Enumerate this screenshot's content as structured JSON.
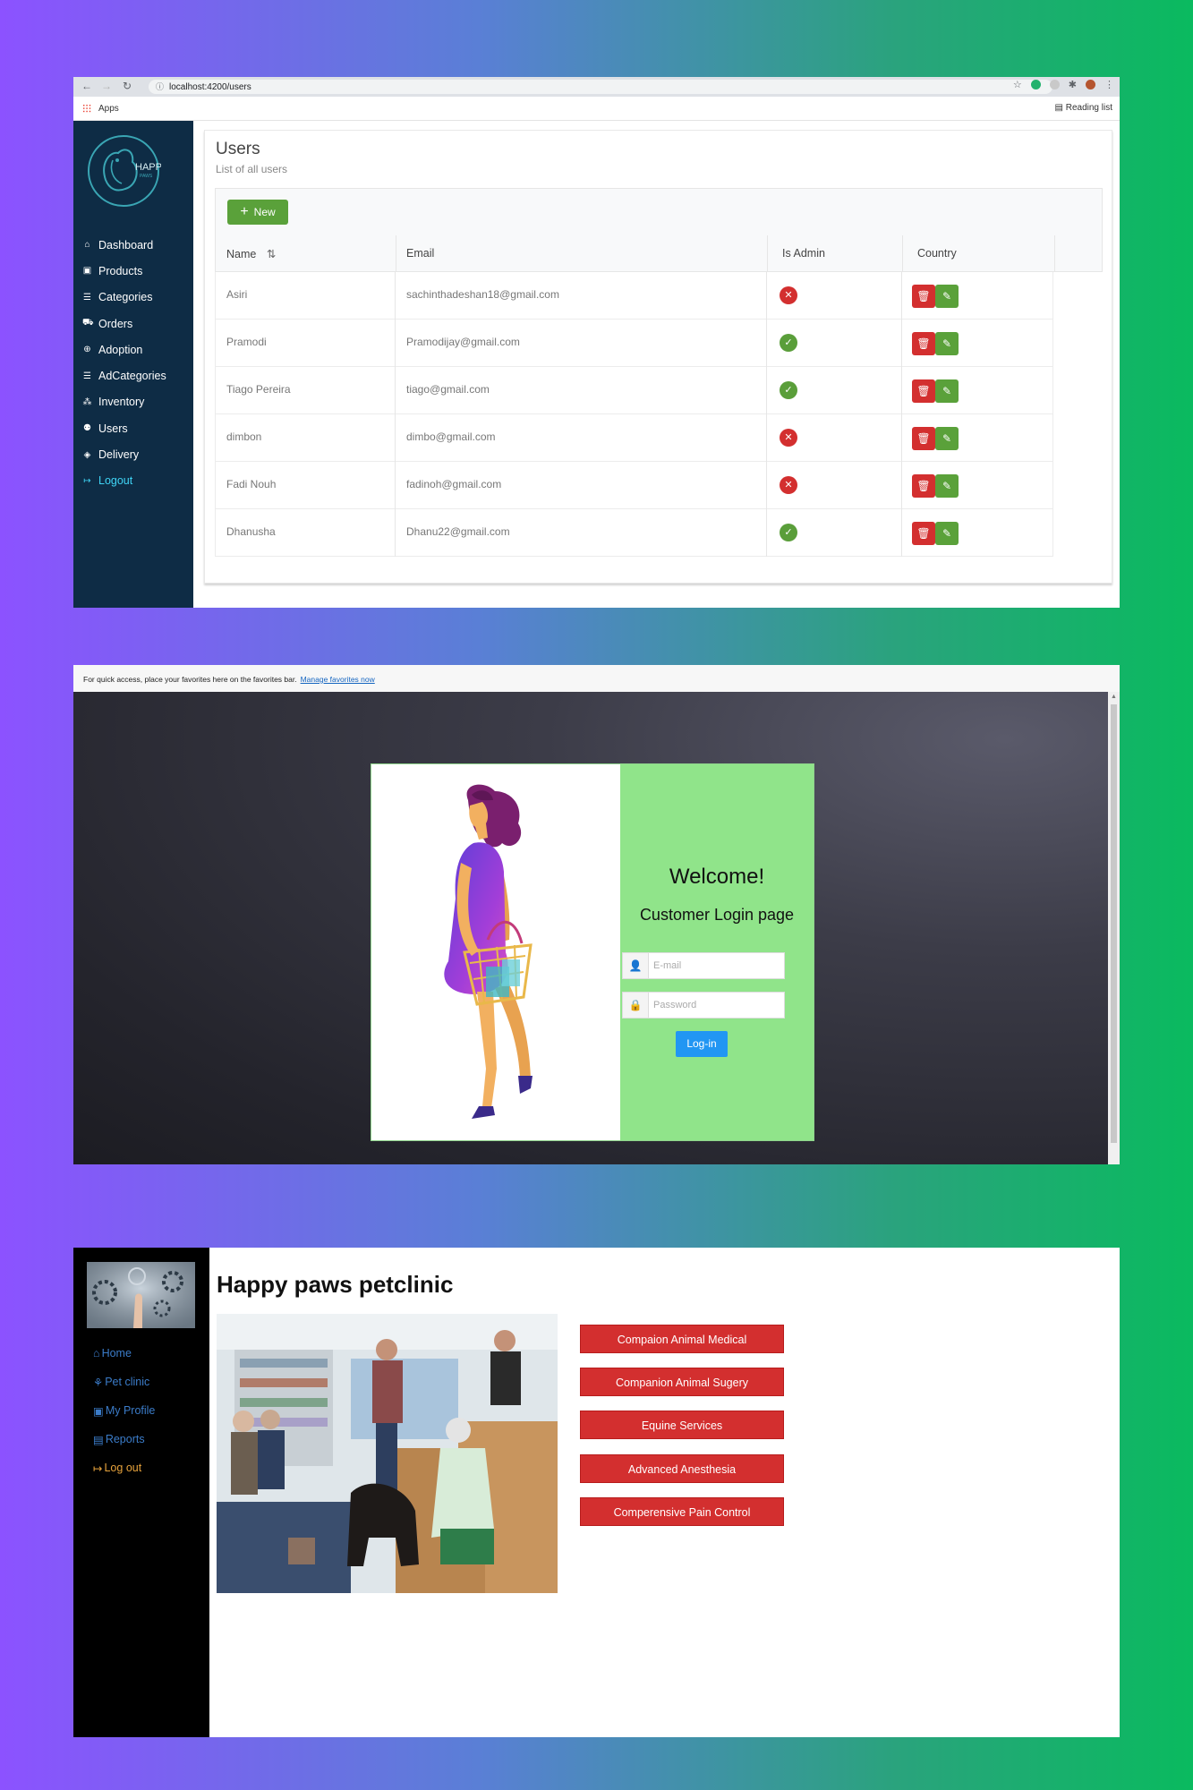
{
  "panel1": {
    "browser": {
      "url": "localhost:4200/users",
      "bookmark_apps": "Apps",
      "reading_list": "Reading list"
    },
    "sidebar": {
      "logo_text": "HAPPY",
      "logo_subtext": "PAWS",
      "items": [
        {
          "label": "Dashboard",
          "icon": "home-icon"
        },
        {
          "label": "Products",
          "icon": "box-icon"
        },
        {
          "label": "Categories",
          "icon": "list-icon"
        },
        {
          "label": "Orders",
          "icon": "cart-icon"
        },
        {
          "label": "Adoption",
          "icon": "globe-icon"
        },
        {
          "label": "AdCategories",
          "icon": "list-icon"
        },
        {
          "label": "Inventory",
          "icon": "sitemap-icon"
        },
        {
          "label": "Users",
          "icon": "users-icon"
        },
        {
          "label": "Delivery",
          "icon": "diamond-icon"
        },
        {
          "label": "Logout",
          "icon": "logout-icon"
        }
      ]
    },
    "page": {
      "title": "Users",
      "subtitle": "List of all users",
      "new_button": "New"
    },
    "table": {
      "columns": [
        "Name",
        "Email",
        "Is Admin",
        "Country"
      ],
      "rows": [
        {
          "name": "Asiri",
          "email": "sachinthadeshan18@gmail.com",
          "is_admin": false
        },
        {
          "name": "Pramodi",
          "email": "Pramodijay@gmail.com",
          "is_admin": true
        },
        {
          "name": "Tiago Pereira",
          "email": "tiago@gmail.com",
          "is_admin": true
        },
        {
          "name": "dimbon",
          "email": "dimbo@gmail.com",
          "is_admin": false
        },
        {
          "name": "Fadi Nouh",
          "email": "fadinoh@gmail.com",
          "is_admin": false
        },
        {
          "name": "Dhanusha",
          "email": "Dhanu22@gmail.com",
          "is_admin": true
        }
      ]
    },
    "colors": {
      "sidebar": "#0e2c45",
      "new_button": "#5aa13a",
      "delete": "#d32f2f",
      "edit": "#5aa13a",
      "active_nav": "#3fd4f5"
    }
  },
  "panel2": {
    "favorites_bar": {
      "text": "For quick access, place your favorites here on the favorites bar.",
      "link": "Manage favorites now"
    },
    "login": {
      "welcome": "Welcome!",
      "heading": "Customer Login page",
      "email_placeholder": "E-mail",
      "password_placeholder": "Password",
      "button": "Log-in"
    },
    "colors": {
      "login_panel": "#90e48a",
      "button": "#2196f3"
    }
  },
  "panel3": {
    "sidebar": {
      "items": [
        {
          "label": "Home",
          "icon": "home-icon"
        },
        {
          "label": "Pet clinic",
          "icon": "clinic-icon"
        },
        {
          "label": "My Profile",
          "icon": "profile-icon"
        },
        {
          "label": "Reports",
          "icon": "report-icon"
        },
        {
          "label": "Log out",
          "icon": "logout-icon"
        }
      ]
    },
    "title": "Happy paws petclinic",
    "services": [
      "Compaion Animal Medical",
      "Companion Animal Sugery",
      "Equine Services",
      "Advanced Anesthesia",
      "Comperensive Pain Control"
    ],
    "colors": {
      "service_button": "#d32f2f",
      "nav_link": "#3b7cc9",
      "logout": "#e6a23c"
    }
  }
}
